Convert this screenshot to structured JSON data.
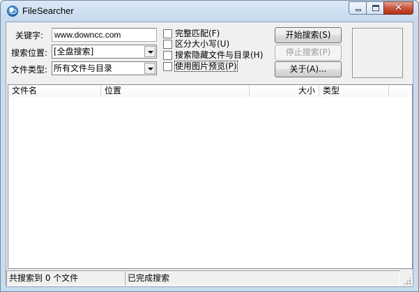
{
  "window": {
    "title": "FileSearcher"
  },
  "form": {
    "keyword_label": "关键字:",
    "keyword_value": "www.downcc.com",
    "location_label": "搜索位置:",
    "location_value": "[全盘搜索]",
    "filetype_label": "文件类型:",
    "filetype_value": "所有文件与目录"
  },
  "options": {
    "exact_match": "完整匹配(F)",
    "case_sensitive": "区分大小写(U)",
    "search_hidden": "搜索隐藏文件与目录(H)",
    "image_preview": "使用图片预览(P)"
  },
  "buttons": {
    "start": "开始搜索(S)",
    "stop": "停止搜索(P)",
    "about": "关于(A)..."
  },
  "results": {
    "columns": [
      "文件名",
      "位置",
      "大小",
      "类型"
    ]
  },
  "status": {
    "count": "共搜索到 0 个文件",
    "state": "已完成搜索"
  }
}
